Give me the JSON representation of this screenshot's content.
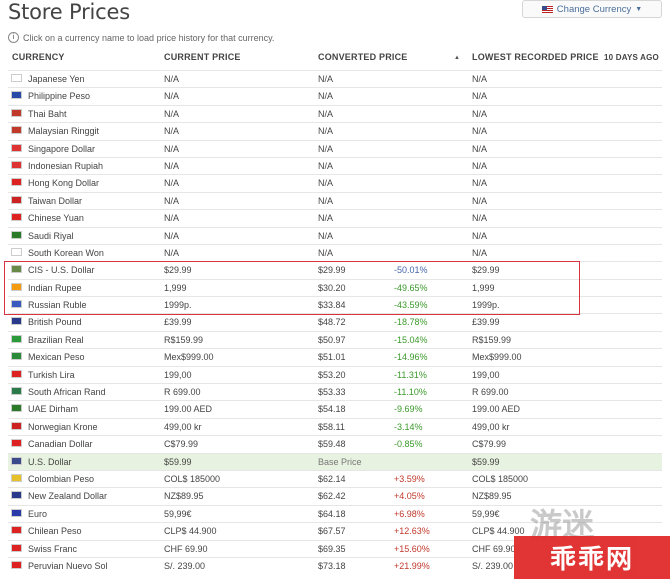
{
  "page": {
    "title": "Store Prices"
  },
  "change_currency": {
    "label": "Change Currency"
  },
  "hint": "Click on a currency name to load price history for that currency.",
  "columns": {
    "currency": "CURRENCY",
    "current": "CURRENT PRICE",
    "converted": "CONVERTED PRICE",
    "lowest": "LOWEST RECORDED PRICE",
    "age": "10 DAYS AGO"
  },
  "rows": [
    {
      "name": "Japanese Yen",
      "current": "N/A",
      "converted": "N/A",
      "pct": "",
      "lowest": "N/A",
      "flag": "#ffffff"
    },
    {
      "name": "Philippine Peso",
      "current": "N/A",
      "converted": "N/A",
      "pct": "",
      "lowest": "N/A",
      "flag": "#2a4aa8"
    },
    {
      "name": "Thai Baht",
      "current": "N/A",
      "converted": "N/A",
      "pct": "",
      "lowest": "N/A",
      "flag": "#c0392b"
    },
    {
      "name": "Malaysian Ringgit",
      "current": "N/A",
      "converted": "N/A",
      "pct": "",
      "lowest": "N/A",
      "flag": "#c0392b"
    },
    {
      "name": "Singapore Dollar",
      "current": "N/A",
      "converted": "N/A",
      "pct": "",
      "lowest": "N/A",
      "flag": "#d33"
    },
    {
      "name": "Indonesian Rupiah",
      "current": "N/A",
      "converted": "N/A",
      "pct": "",
      "lowest": "N/A",
      "flag": "#d33"
    },
    {
      "name": "Hong Kong Dollar",
      "current": "N/A",
      "converted": "N/A",
      "pct": "",
      "lowest": "N/A",
      "flag": "#d22"
    },
    {
      "name": "Taiwan Dollar",
      "current": "N/A",
      "converted": "N/A",
      "pct": "",
      "lowest": "N/A",
      "flag": "#c22"
    },
    {
      "name": "Chinese Yuan",
      "current": "N/A",
      "converted": "N/A",
      "pct": "",
      "lowest": "N/A",
      "flag": "#d22"
    },
    {
      "name": "Saudi Riyal",
      "current": "N/A",
      "converted": "N/A",
      "pct": "",
      "lowest": "N/A",
      "flag": "#2a7a2a"
    },
    {
      "name": "South Korean Won",
      "current": "N/A",
      "converted": "N/A",
      "pct": "",
      "lowest": "N/A",
      "flag": "#ffffff"
    },
    {
      "name": "CIS - U.S. Dollar",
      "current": "$29.99",
      "converted": "$29.99",
      "pct": "-50.01%",
      "lowest": "$29.99",
      "flag": "#6a8a4a",
      "pct_style": "neg-strong"
    },
    {
      "name": "Indian Rupee",
      "current": "1,999",
      "converted": "$30.20",
      "pct": "-49.65%",
      "lowest": "1,999",
      "flag": "#f39c12",
      "pct_style": "neg"
    },
    {
      "name": "Russian Ruble",
      "current": "1999p.",
      "converted": "$33.84",
      "pct": "-43.59%",
      "lowest": "1999p.",
      "flag": "#3a5ac0",
      "pct_style": "neg"
    },
    {
      "name": "British Pound",
      "current": "£39.99",
      "converted": "$48.72",
      "pct": "-18.78%",
      "lowest": "£39.99",
      "flag": "#2a3a8a",
      "pct_style": "neg"
    },
    {
      "name": "Brazilian Real",
      "current": "R$159.99",
      "converted": "$50.97",
      "pct": "-15.04%",
      "lowest": "R$159.99",
      "flag": "#2a9a3a",
      "pct_style": "neg"
    },
    {
      "name": "Mexican Peso",
      "current": "Mex$999.00",
      "converted": "$51.01",
      "pct": "-14.96%",
      "lowest": "Mex$999.00",
      "flag": "#2a8a3a",
      "pct_style": "neg"
    },
    {
      "name": "Turkish Lira",
      "current": "199,00",
      "converted": "$53.20",
      "pct": "-11.31%",
      "lowest": "199,00",
      "flag": "#d22",
      "pct_style": "neg"
    },
    {
      "name": "South African Rand",
      "current": "R 699.00",
      "converted": "$53.33",
      "pct": "-11.10%",
      "lowest": "R 699.00",
      "flag": "#2a7a4a",
      "pct_style": "neg"
    },
    {
      "name": "UAE Dirham",
      "current": "199.00 AED",
      "converted": "$54.18",
      "pct": "-9.69%",
      "lowest": "199.00 AED",
      "flag": "#2a7a2a",
      "pct_style": "neg"
    },
    {
      "name": "Norwegian Krone",
      "current": "499,00 kr",
      "converted": "$58.11",
      "pct": "-3.14%",
      "lowest": "499,00 kr",
      "flag": "#c22",
      "pct_style": "neg"
    },
    {
      "name": "Canadian Dollar",
      "current": "C$79.99",
      "converted": "$59.48",
      "pct": "-0.85%",
      "lowest": "C$79.99",
      "flag": "#d22",
      "pct_style": "neg"
    },
    {
      "name": "U.S. Dollar",
      "current": "$59.99",
      "converted": "Base Price",
      "pct": "",
      "lowest": "$59.99",
      "flag": "#3a4a8a",
      "highlight": true
    },
    {
      "name": "Colombian Peso",
      "current": "COL$ 185000",
      "converted": "$62.14",
      "pct": "+3.59%",
      "lowest": "COL$ 185000",
      "flag": "#e6c12a",
      "pct_style": "pos"
    },
    {
      "name": "New Zealand Dollar",
      "current": "NZ$89.95",
      "converted": "$62.42",
      "pct": "+4.05%",
      "lowest": "NZ$89.95",
      "flag": "#2a3a8a",
      "pct_style": "pos"
    },
    {
      "name": "Euro",
      "current": "59,99€",
      "converted": "$64.18",
      "pct": "+6.98%",
      "lowest": "59,99€",
      "flag": "#2a3aa8",
      "pct_style": "pos"
    },
    {
      "name": "Chilean Peso",
      "current": "CLP$ 44.900",
      "converted": "$67.57",
      "pct": "+12.63%",
      "lowest": "CLP$ 44.900",
      "flag": "#d22",
      "pct_style": "pos"
    },
    {
      "name": "Swiss Franc",
      "current": "CHF 69.90",
      "converted": "$69.35",
      "pct": "+15.60%",
      "lowest": "CHF 69.90",
      "flag": "#d22",
      "pct_style": "pos"
    },
    {
      "name": "Peruvian Nuevo Sol",
      "current": "S/. 239.00",
      "converted": "$73.18",
      "pct": "+21.99%",
      "lowest": "S/. 239.00",
      "flag": "#d22",
      "pct_style": "pos"
    }
  ],
  "watermark": {
    "text": "乖乖网",
    "ghost": "游迷"
  }
}
